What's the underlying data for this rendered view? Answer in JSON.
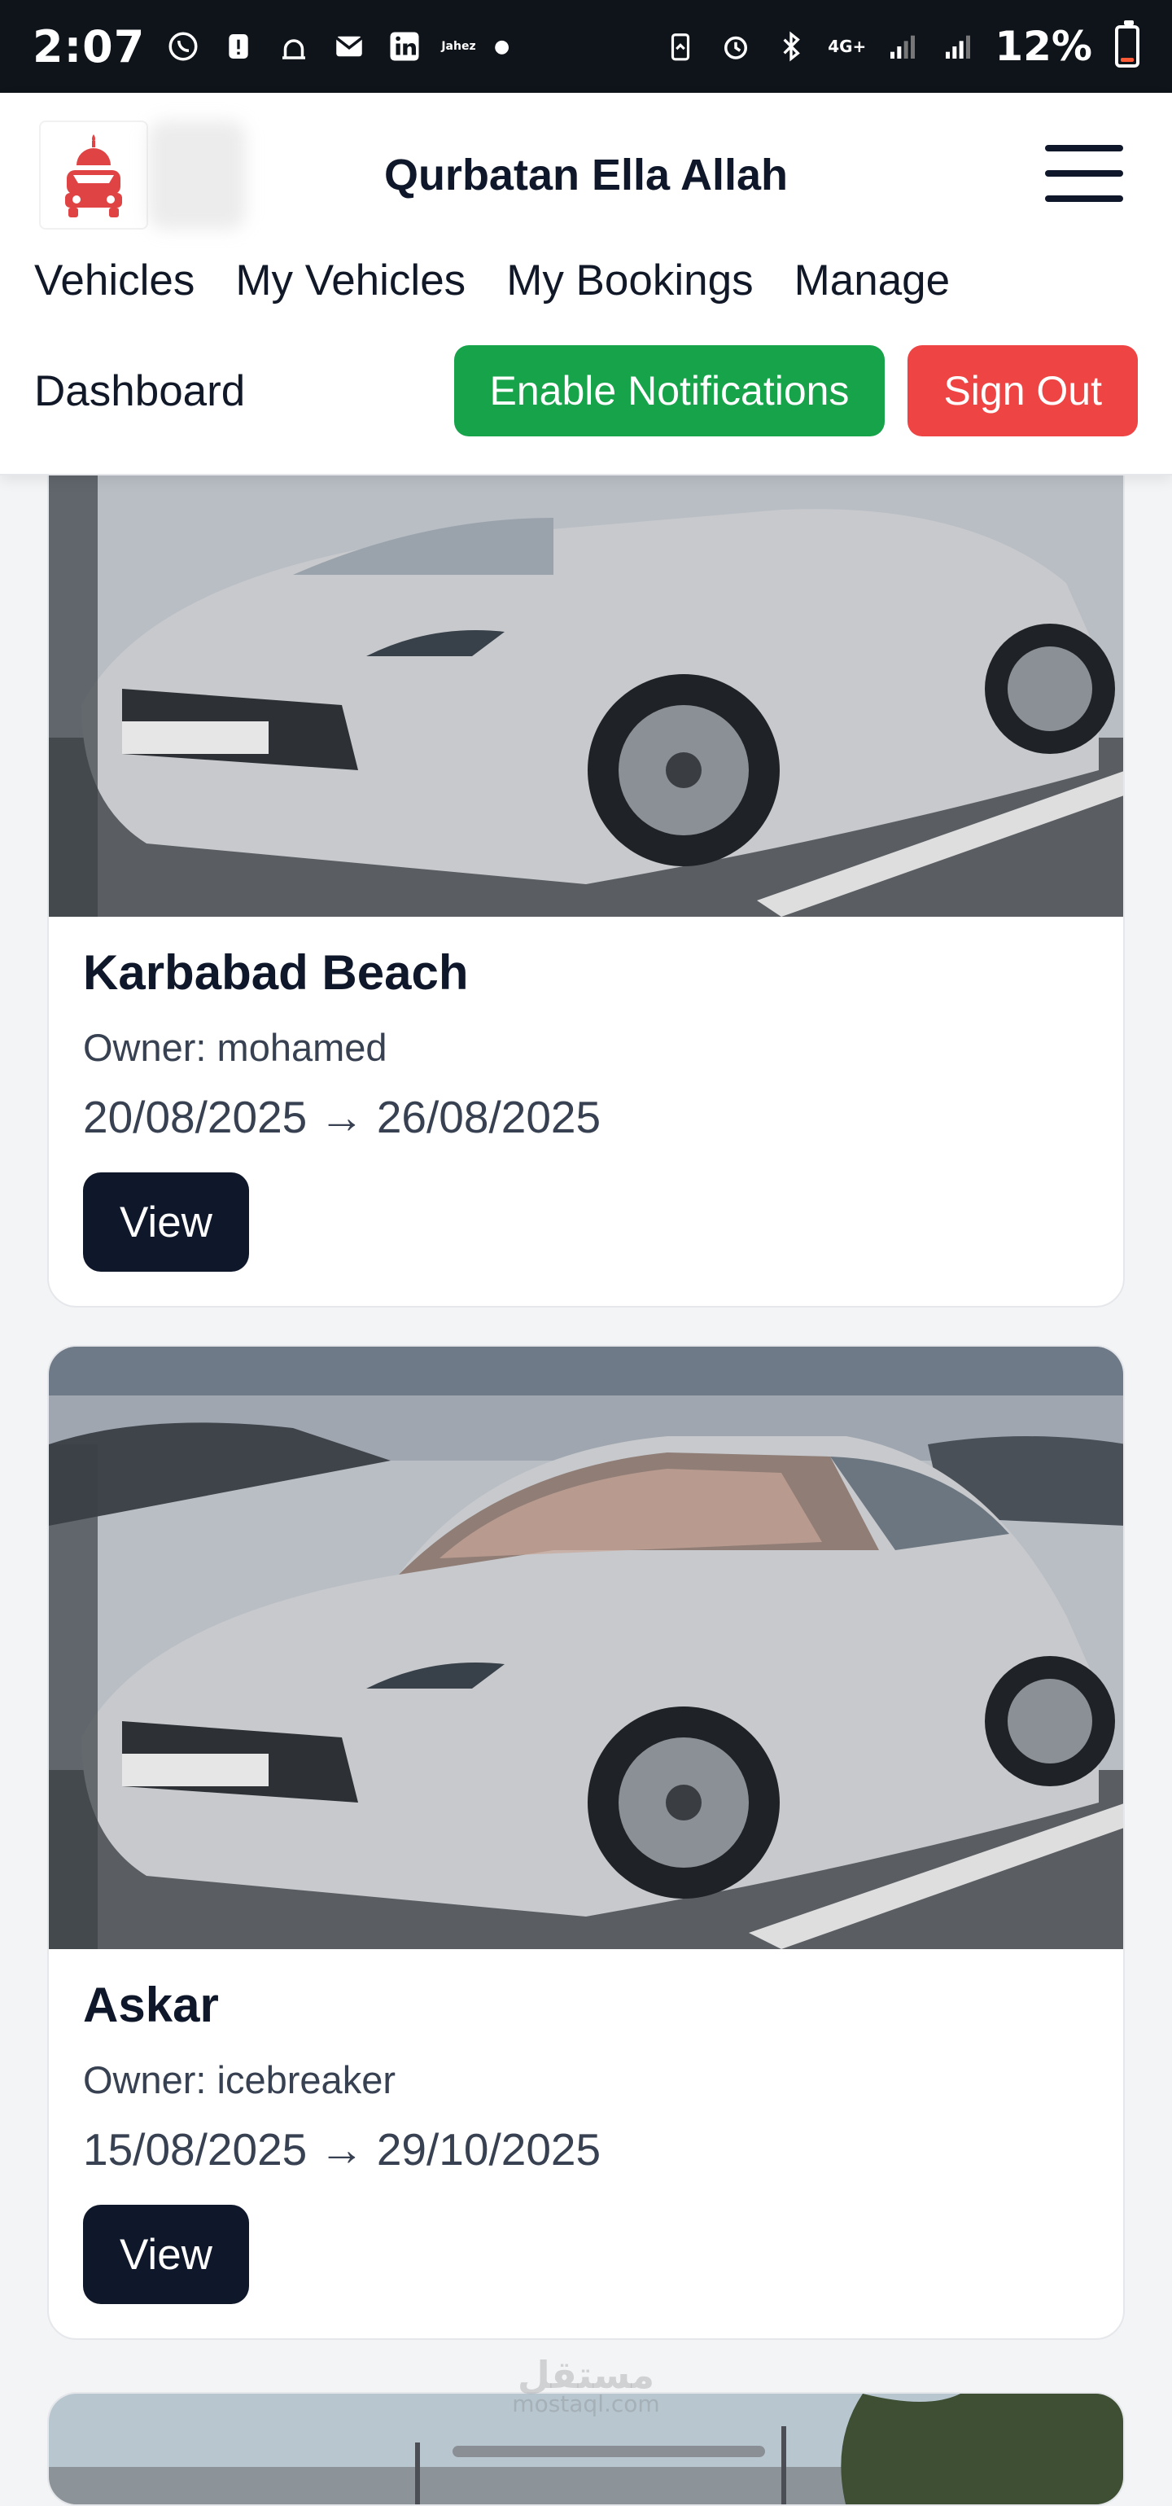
{
  "status_bar": {
    "time": "2:07",
    "network_label": "4G+",
    "battery_text": "12%",
    "small_label": "Jahez"
  },
  "header": {
    "title": "Qurbatan Ella Allah",
    "nav": [
      "Vehicles",
      "My Vehicles",
      "My Bookings",
      "Manage"
    ],
    "dashboard_label": "Dashboard",
    "enable_notifications_label": "Enable Notifications",
    "sign_out_label": "Sign Out",
    "colors": {
      "enable_notifications": "#16a34a",
      "sign_out": "#ef4444",
      "primary_dark": "#0f172a"
    }
  },
  "bookings": [
    {
      "title": "Karbabad Beach",
      "owner": "Owner: mohamed",
      "dates": "20/08/2025 → 26/08/2025",
      "view_label": "View"
    },
    {
      "title": "Askar",
      "owner": "Owner: icebreaker",
      "dates": "15/08/2025 → 29/10/2025",
      "view_label": "View"
    }
  ],
  "watermark": {
    "arabic": "مستقل",
    "latin": "mostaql.com"
  }
}
